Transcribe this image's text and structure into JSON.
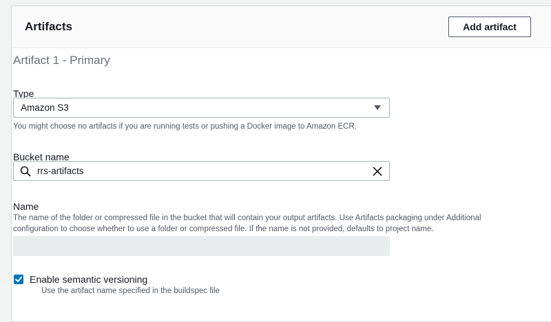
{
  "panel": {
    "title": "Artifacts",
    "add_button_label": "Add artifact"
  },
  "artifact": {
    "section_title": "Artifact 1 - Primary",
    "type": {
      "label": "Type",
      "selected": "Amazon S3",
      "hint": "You might choose no artifacts if you are running tests or pushing a Docker image to Amazon ECR."
    },
    "bucket": {
      "label": "Bucket name",
      "value": "rrs-artifacts",
      "icon": "search-icon",
      "clear_icon": "close-icon"
    },
    "name": {
      "label": "Name",
      "hint_line1": "The name of the folder or compressed file in the bucket that will contain your output artifacts. Use Artifacts packaging under Additional",
      "hint_line2": "configuration to choose whether to use a folder or compressed file. If the name is not provided, defaults to project name.",
      "value": ""
    },
    "semantic_versioning": {
      "label": "Enable semantic versioning",
      "checked": true,
      "hint": "Use the artifact name specified in the buildspec file"
    }
  },
  "colors": {
    "accent": "#0073bb",
    "border": "#aab7b8",
    "muted_text": "#545b64",
    "disabled_bg": "#eaeded"
  }
}
